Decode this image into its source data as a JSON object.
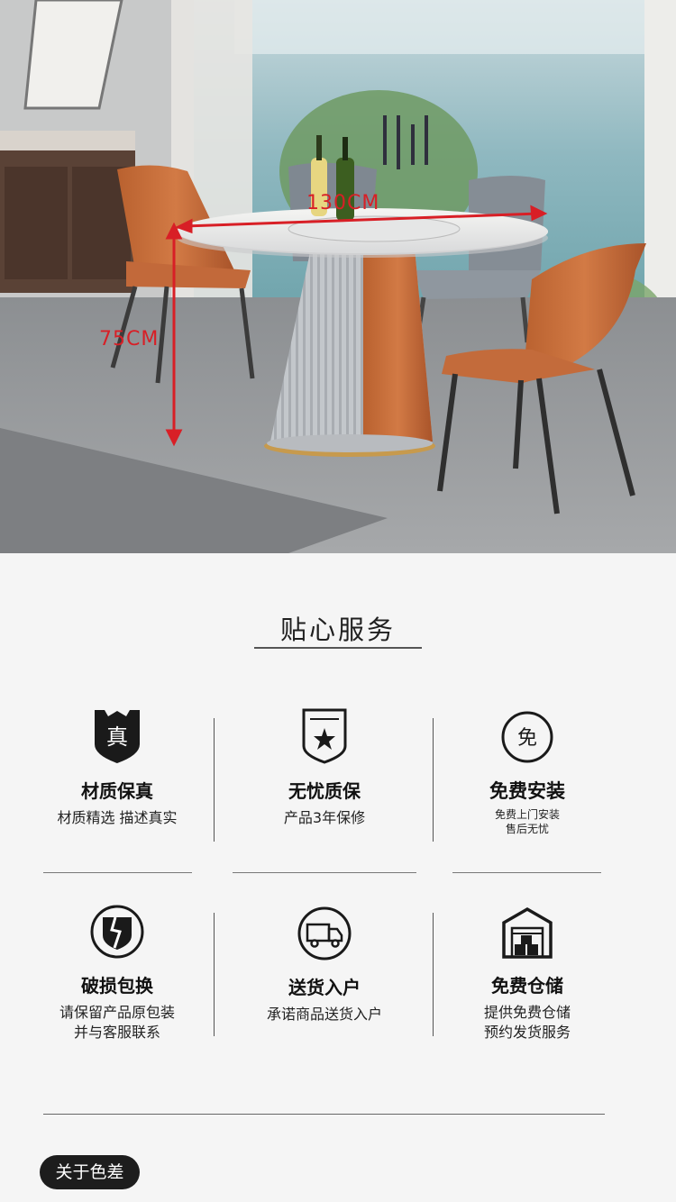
{
  "hero": {
    "width_label": "130CM",
    "height_label": "75CM"
  },
  "section": {
    "title": "贴心服务"
  },
  "services": [
    {
      "icon": "shield-genuine-icon",
      "badge": "真",
      "name": "材质保真",
      "desc": "材质精选  描述真实"
    },
    {
      "icon": "quality-badge-icon",
      "name": "无忧质保",
      "desc": "产品3年保修"
    },
    {
      "icon": "free-circle-icon",
      "badge": "免",
      "name": "免费安装",
      "desc_lines": [
        "免费上门安装",
        "售后无忧"
      ]
    },
    {
      "icon": "broken-shield-icon",
      "name": "破损包换",
      "desc_lines": [
        "请保留产品原包装",
        "并与客服联系"
      ]
    },
    {
      "icon": "delivery-truck-icon",
      "name": "送货入户",
      "desc": "承诺商品送货入户"
    },
    {
      "icon": "warehouse-icon",
      "name": "免费仓储",
      "desc_lines": [
        "提供免费仓储",
        "预约发货服务"
      ]
    }
  ],
  "footer": {
    "tag": "关于色差"
  }
}
